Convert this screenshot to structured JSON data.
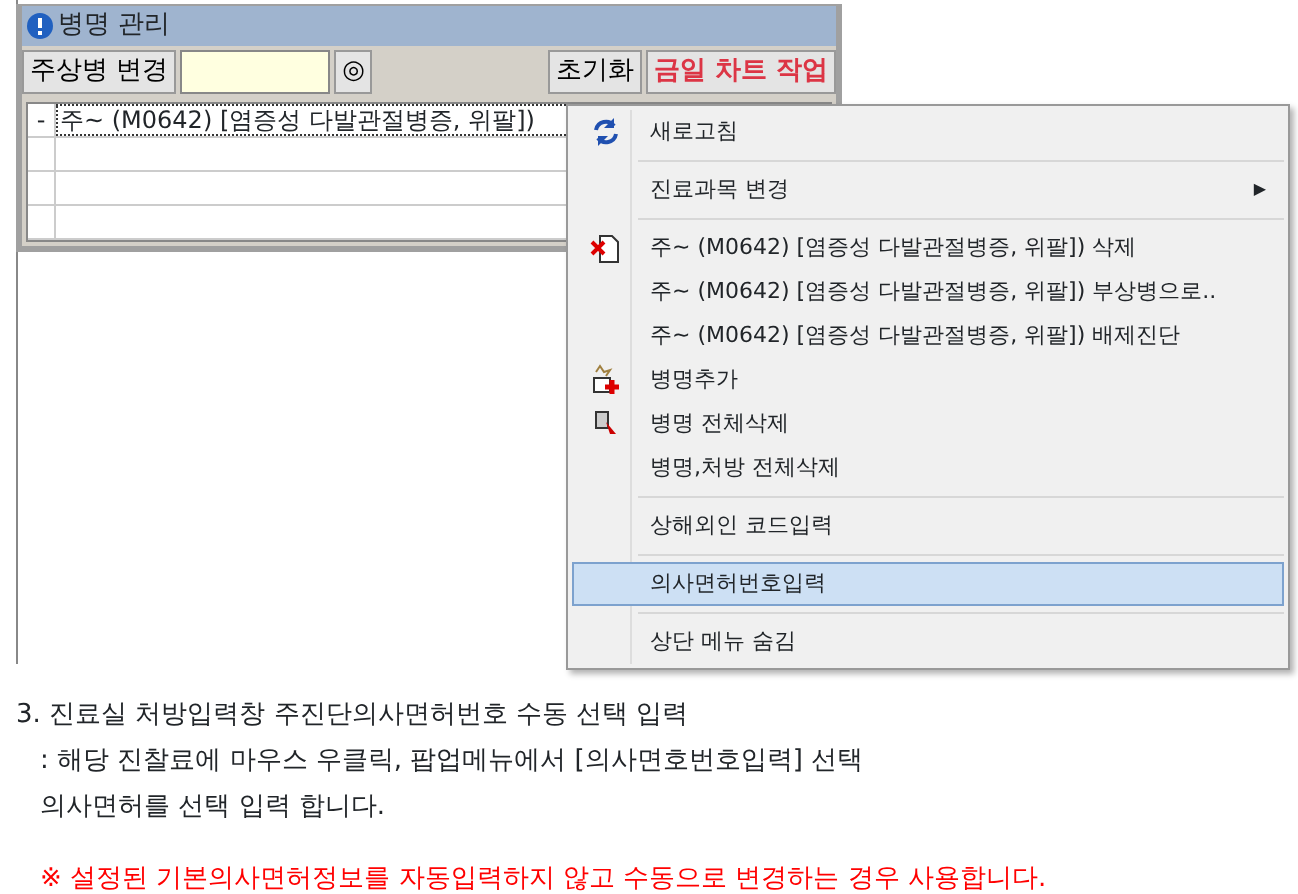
{
  "window": {
    "title": "병명 관리"
  },
  "toolbar": {
    "main_button": "주상병 변경",
    "circle_button": "◎",
    "reset_button": "초기화",
    "chart_button": "금일 차트 작업"
  },
  "grid": {
    "rows": [
      {
        "marker": "-",
        "text": "주~ (M0642) [염증성 다발관절병증, 위팔])",
        "focused": true
      },
      {
        "marker": "",
        "text": "",
        "focused": false
      },
      {
        "marker": "",
        "text": "",
        "focused": false
      },
      {
        "marker": "",
        "text": "",
        "focused": false
      }
    ]
  },
  "context_menu": {
    "items": [
      {
        "kind": "item",
        "label": "새로고침",
        "selected": false
      },
      {
        "kind": "separator"
      },
      {
        "kind": "item",
        "label": "진료과목 변경",
        "arrow": "▶",
        "selected": false
      },
      {
        "kind": "separator"
      },
      {
        "kind": "item",
        "label": "주~ (M0642) [염증성 다발관절병증, 위팔]) 삭제",
        "selected": false
      },
      {
        "kind": "item",
        "label": "주~ (M0642) [염증성 다발관절병증, 위팔]) 부상병으로..",
        "selected": false
      },
      {
        "kind": "item",
        "label": "주~ (M0642) [염증성 다발관절병증, 위팔]) 배제진단",
        "selected": false
      },
      {
        "kind": "item",
        "label": "병명추가",
        "selected": false
      },
      {
        "kind": "item",
        "label": "병명 전체삭제",
        "selected": false
      },
      {
        "kind": "item",
        "label": "병명,처방 전체삭제",
        "selected": false
      },
      {
        "kind": "separator"
      },
      {
        "kind": "item",
        "label": "상해외인 코드입력",
        "selected": false
      },
      {
        "kind": "separator"
      },
      {
        "kind": "item",
        "label": "의사면허번호입력",
        "selected": true
      },
      {
        "kind": "separator"
      },
      {
        "kind": "item",
        "label": "상단 메뉴 숨김",
        "selected": false
      }
    ]
  },
  "description": {
    "lines": [
      "3. 진료실 처방입력창 주진단의사면허번호  수동 선택 입력",
      ": 해당 진찰료에 마우스 우클릭, 팝업메뉴에서 [의사면호번호입력] 선택",
      "의사면허를 선택 입력 합니다."
    ],
    "note": "※ 설정된 기본의사면허정보를 자동입력하지 않고 수동으로 변경하는 경우 사용합니다."
  }
}
